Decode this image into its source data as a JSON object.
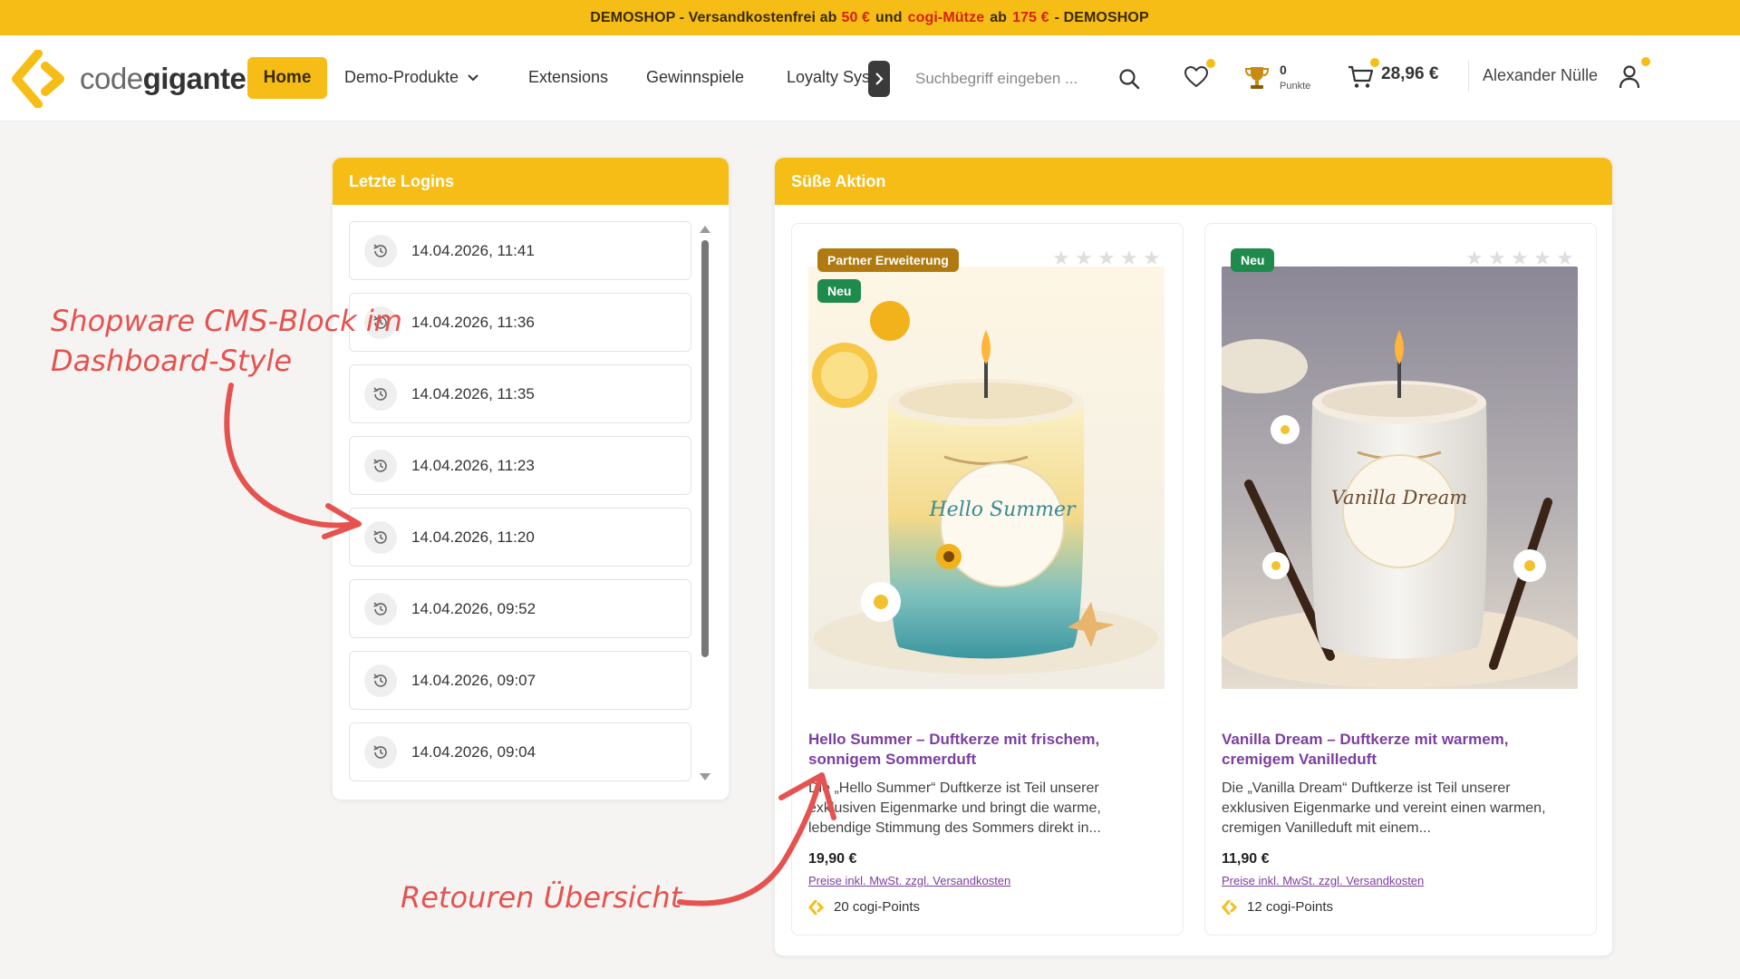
{
  "banner": {
    "part1": "DEMOSHOP - Versandkostenfrei ab",
    "amount1": "50 €",
    "part2": "und",
    "item": "cogi-Mütze",
    "part3": "ab",
    "amount2": "175 €",
    "part4": "- DEMOSHOP",
    "color": "#f6bd16",
    "accent_red": "#d6210e"
  },
  "header": {
    "logo_light": "code",
    "logo_bold": "giganten",
    "nav": {
      "home": "Home",
      "demo_produkte": "Demo-Produkte",
      "extensions": "Extensions",
      "gewinnspiele": "Gewinnspiele",
      "loyalty": "Loyalty System"
    },
    "search_placeholder": "Suchbegriff eingeben ...",
    "points_value": "0",
    "points_label": "Punkte",
    "cart_total": "28,96 €",
    "user_name": "Alexander Nülle",
    "icons": [
      "search-icon",
      "heart-icon",
      "trophy-icon",
      "cart-icon",
      "user-icon",
      "chevron-right-icon",
      "chevron-down-icon"
    ]
  },
  "logins": {
    "title": "Letzte Logins",
    "items": [
      "14.04.2026, 11:41",
      "14.04.2026, 11:36",
      "14.04.2026, 11:35",
      "14.04.2026, 11:23",
      "14.04.2026, 11:20",
      "14.04.2026, 09:52",
      "14.04.2026, 09:07",
      "14.04.2026, 09:04"
    ]
  },
  "promo": {
    "title": "Süße Aktion",
    "products": [
      {
        "badge_partner": "Partner Erweiterung",
        "badge_new": "Neu",
        "label_text": "Hello Summer",
        "title": "Hello Summer – Duftkerze mit frischem, sonnigem Sommerduft",
        "description": "Die „Hello Summer“ Duftkerze ist Teil unserer exklusiven Eigenmarke und bringt die warme, lebendige Stimmung des Sommers direkt in...",
        "price": "19,90 €",
        "tax_note": "Preise inkl. MwSt. zzgl. Versandkosten",
        "points": "20 cogi-Points"
      },
      {
        "badge_new": "Neu",
        "label_text": "Vanilla Dream",
        "title": "Vanilla Dream – Duftkerze mit warmem, cremigem Vanilleduft",
        "description": "Die „Vanilla Dream“ Duftkerze ist Teil unserer exklusiven Eigenmarke und vereint einen warmen, cremigen Vanilleduft mit einem...",
        "price": "11,90 €",
        "tax_note": "Preise inkl. MwSt. zzgl. Versandkosten",
        "points": "12 cogi-Points"
      }
    ]
  },
  "annotations": {
    "left_line1": "Shopware CMS-Block im",
    "left_line2": "Dashboard-Style",
    "bottom": "Retouren Übersicht",
    "color": "#e5524f"
  }
}
